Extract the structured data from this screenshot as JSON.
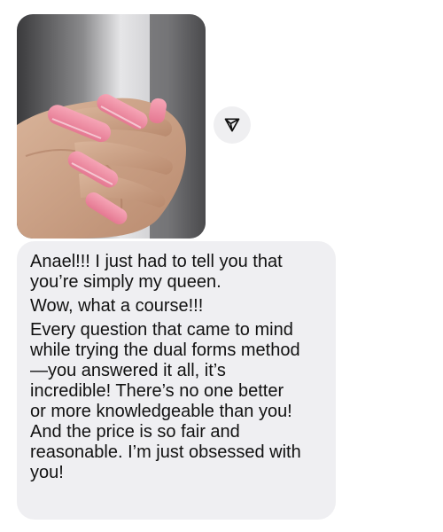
{
  "conversation": {
    "photo": {
      "description_icon": "photo-pink-nails"
    },
    "share_icon": "paper-plane-icon",
    "message": {
      "paragraphs": [
        [
          "Anael!!! I just had to tell you that",
          "you’re simply my queen."
        ],
        [
          "Wow, what a course!!!"
        ],
        [
          "Every question that came to mind",
          "while trying the dual forms method",
          "—you answered it all, it’s",
          "incredible! There’s no one better",
          "or more knowledgeable than you!",
          "And the price is so fair and",
          "reasonable. I’m just obsessed with",
          "you!"
        ]
      ]
    }
  },
  "colors": {
    "bubble_bg": "#efeff2",
    "nail_pink": "#ee8aa0",
    "share_bg": "#efeff1"
  }
}
